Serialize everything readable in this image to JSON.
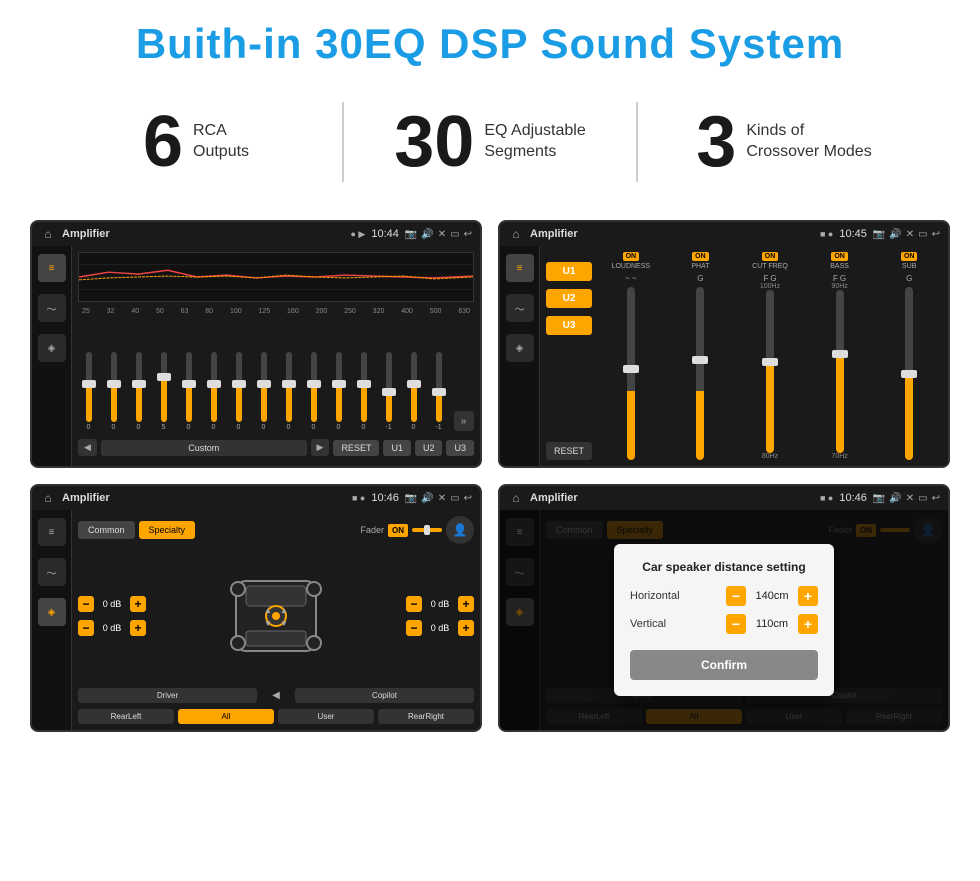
{
  "page": {
    "title": "Buith-in 30EQ DSP Sound System"
  },
  "stats": [
    {
      "number": "6",
      "label": "RCA\nOutputs"
    },
    {
      "number": "30",
      "label": "EQ Adjustable\nSegments"
    },
    {
      "number": "3",
      "label": "Kinds of\nCrossover Modes"
    }
  ],
  "screens": {
    "eq": {
      "status": {
        "title": "Amplifier",
        "time": "10:44"
      },
      "frequencies": [
        "25",
        "32",
        "40",
        "50",
        "63",
        "80",
        "100",
        "125",
        "160",
        "200",
        "250",
        "320",
        "400",
        "500",
        "630"
      ],
      "values": [
        "0",
        "0",
        "0",
        "5",
        "0",
        "0",
        "0",
        "0",
        "0",
        "0",
        "0",
        "0",
        "-1",
        "0",
        "-1"
      ],
      "preset": "Custom",
      "buttons": [
        "RESET",
        "U1",
        "U2",
        "U3"
      ]
    },
    "crossover": {
      "status": {
        "title": "Amplifier",
        "time": "10:45"
      },
      "presets": [
        "U1",
        "U2",
        "U3"
      ],
      "channels": [
        "LOUDNESS",
        "PHAT",
        "CUT FREQ",
        "BASS",
        "SUB"
      ],
      "reset_label": "RESET"
    },
    "speaker": {
      "status": {
        "title": "Amplifier",
        "time": "10:46"
      },
      "tabs": [
        "Common",
        "Specialty"
      ],
      "fader_label": "Fader",
      "fader_on": "ON",
      "controls": [
        {
          "label": "0 dB"
        },
        {
          "label": "0 dB"
        },
        {
          "label": "0 dB"
        },
        {
          "label": "0 dB"
        }
      ],
      "bottom_buttons": [
        "Driver",
        "",
        "Copilot",
        "RearLeft",
        "All",
        "User",
        "RearRight"
      ]
    },
    "speaker_dialog": {
      "status": {
        "title": "Amplifier",
        "time": "10:46"
      },
      "tabs": [
        "Common",
        "Specialty"
      ],
      "dialog": {
        "title": "Car speaker distance setting",
        "horizontal_label": "Horizontal",
        "horizontal_value": "140cm",
        "vertical_label": "Vertical",
        "vertical_value": "110cm",
        "confirm_label": "Confirm"
      },
      "bottom_buttons": [
        "Driver",
        "",
        "Copilot",
        "RearLeft",
        "All",
        "User",
        "RearRight"
      ]
    }
  },
  "icons": {
    "home": "⌂",
    "pin": "📍",
    "speaker": "🔊",
    "back": "↩",
    "play": "▶",
    "prev": "◀",
    "eq_icon": "≡",
    "wave": "~",
    "arrow_right": "»",
    "profile": "👤"
  }
}
